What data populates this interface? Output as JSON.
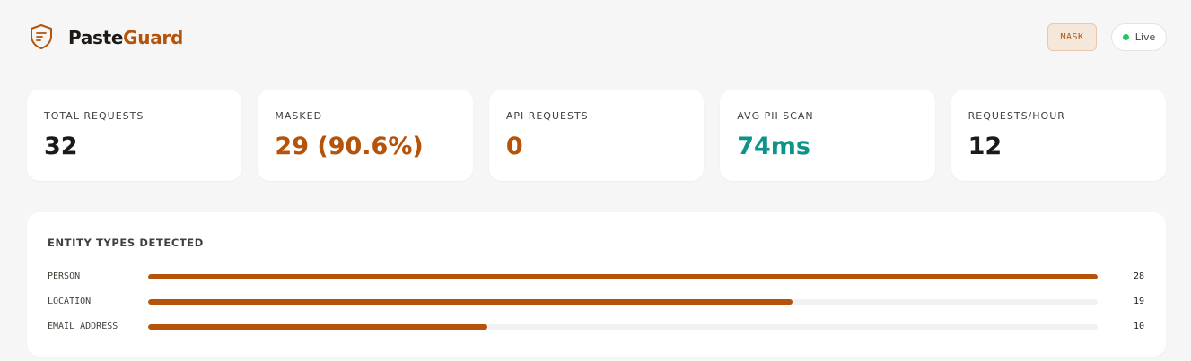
{
  "header": {
    "brand_part1": "Paste",
    "brand_part2": "Guard",
    "logo_icon": "shield-icon",
    "mode_badge": "MASK",
    "live_label": "Live"
  },
  "colors": {
    "accent": "#b45309",
    "teal": "#0d9488",
    "live": "#22c55e"
  },
  "stats": [
    {
      "label": "TOTAL REQUESTS",
      "value": "32"
    },
    {
      "label": "MASKED",
      "value": "29 (90.6%)"
    },
    {
      "label": "API REQUESTS",
      "value": "0"
    },
    {
      "label": "AVG PII SCAN",
      "value": "74ms"
    },
    {
      "label": "REQUESTS/HOUR",
      "value": "12"
    }
  ],
  "entities": {
    "title": "ENTITY TYPES DETECTED",
    "items": [
      {
        "name": "PERSON",
        "count": "28",
        "fill_fraction": 1.0
      },
      {
        "name": "LOCATION",
        "count": "19",
        "fill_fraction": 0.679
      },
      {
        "name": "EMAIL_ADDRESS",
        "count": "10",
        "fill_fraction": 0.357
      }
    ]
  }
}
